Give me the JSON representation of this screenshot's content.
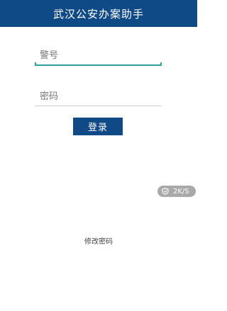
{
  "header": {
    "title": "武汉公安办案助手"
  },
  "form": {
    "badge_number_placeholder": "警号",
    "password_placeholder": "密码",
    "login_label": "登录"
  },
  "overlay": {
    "speed_text": "2K/S",
    "speed_icon": "shield-icon"
  },
  "footer": {
    "change_password_label": "修改密码"
  },
  "colors": {
    "header_bg": "#0f4a86",
    "focus_underline": "#2f9ea1",
    "button_bg": "#0f4a86"
  }
}
